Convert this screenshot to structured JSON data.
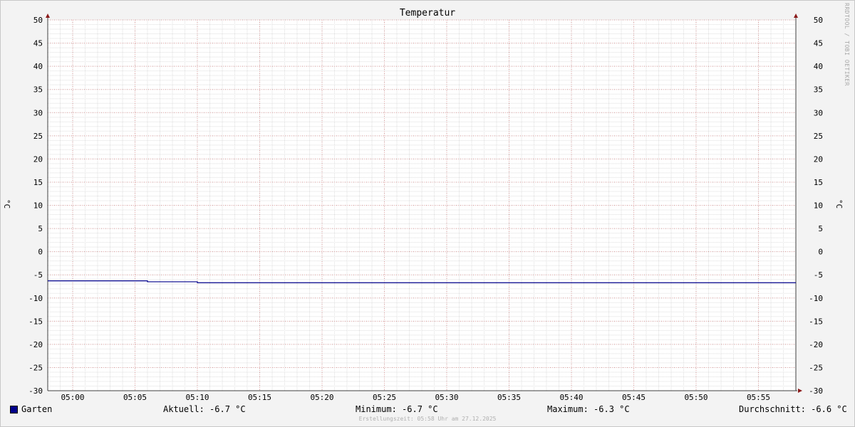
{
  "chart_data": {
    "type": "line",
    "title": "Temperatur",
    "ylabel": "°C",
    "ylabel_right": "°C",
    "ylim": [
      -30,
      50
    ],
    "y_ticks": [
      50,
      45,
      40,
      35,
      30,
      25,
      20,
      15,
      10,
      5,
      0,
      -5,
      -10,
      -15,
      -20,
      -25,
      -30
    ],
    "x_ticks": [
      "05:00",
      "05:05",
      "05:10",
      "05:15",
      "05:20",
      "05:25",
      "05:30",
      "05:35",
      "05:40",
      "05:45",
      "05:50",
      "05:55"
    ],
    "xlim": [
      "04:58",
      "05:58"
    ],
    "grid": true,
    "series": [
      {
        "name": "Garten",
        "color": "#00008b",
        "x": [
          "04:58",
          "05:06",
          "05:06",
          "05:10",
          "05:10",
          "05:58"
        ],
        "values": [
          -6.3,
          -6.3,
          -6.5,
          -6.5,
          -6.7,
          -6.7
        ]
      }
    ]
  },
  "watermark": "RRDTOOL / TOBI OETIKER",
  "legend": {
    "name": "Garten",
    "color": "#00008b",
    "current": "Aktuell: -6.7 °C",
    "minimum": "Minimum: -6.7 °C",
    "maximum": "Maximum: -6.3 °C",
    "average": "Durchschnitt: -6.6 °C"
  },
  "footer": "Erstellungszeit: 05:58 Uhr am 27.12.2025"
}
